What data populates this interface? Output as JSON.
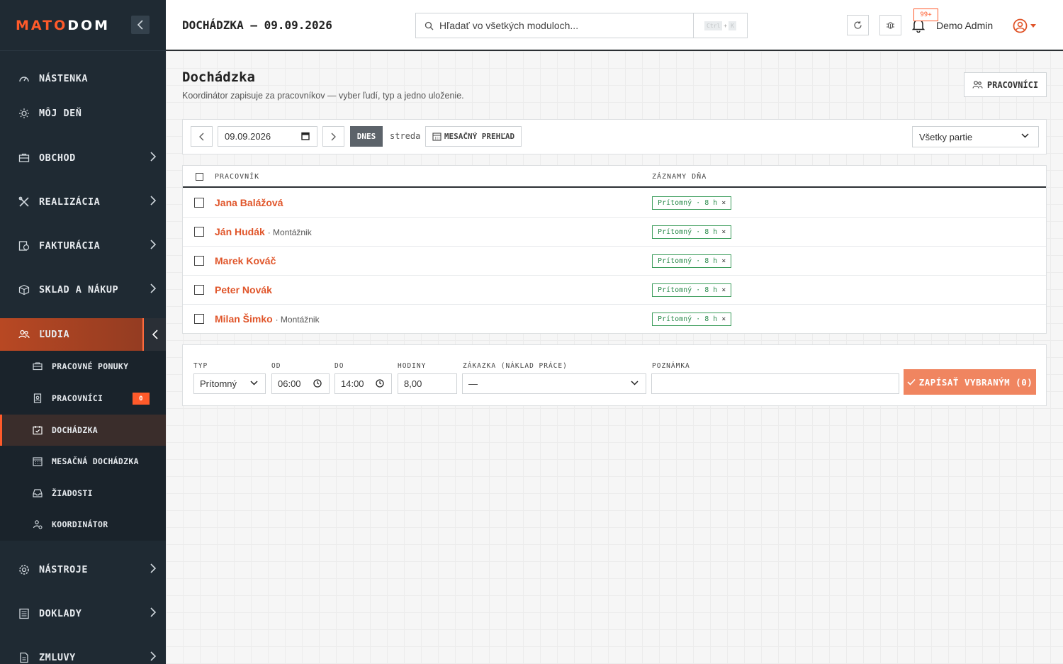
{
  "brand": {
    "logo_part1": "MATO",
    "logo_part2": "DOM"
  },
  "sidebar": {
    "items": [
      {
        "label": "NÁSTENKA",
        "icon": "gauge-icon"
      },
      {
        "label": "MÔJ DEŇ",
        "icon": "sun-icon"
      },
      {
        "label": "OBCHOD",
        "icon": "briefcase-icon"
      },
      {
        "label": "REALIZÁCIA",
        "icon": "tools-icon"
      },
      {
        "label": "FAKTURÁCIA",
        "icon": "invoice-icon"
      },
      {
        "label": "SKLAD A NÁKUP",
        "icon": "box-icon"
      },
      {
        "label": "ĽUDIA",
        "icon": "people-icon"
      },
      {
        "label": "NÁSTROJE",
        "icon": "gear-icon"
      },
      {
        "label": "DOKLADY",
        "icon": "list-icon"
      },
      {
        "label": "ZMLUVY",
        "icon": "document-icon"
      }
    ],
    "sub_items": [
      {
        "label": "PRACOVNÉ PONUKY",
        "icon": "briefcase-icon"
      },
      {
        "label": "PRACOVNÍCI",
        "icon": "badge-icon",
        "badge": "0"
      },
      {
        "label": "DOCHÁDZKA",
        "icon": "calendar-check-icon"
      },
      {
        "label": "MESAČNÁ DOCHÁDZKA",
        "icon": "calendar-grid-icon"
      },
      {
        "label": "ŽIADOSTI",
        "icon": "inbox-icon"
      },
      {
        "label": "KOORDINÁTOR",
        "icon": "coordinator-icon"
      }
    ]
  },
  "topbar": {
    "title": "DOCHÁDZKA — 09.09.2026",
    "search_placeholder": "Hľadať vo všetkých moduloch...",
    "kbd_ctrl": "Ctrl",
    "kbd_plus": "+",
    "kbd_key": "K",
    "notifications_badge": "99+",
    "user_name": "Demo Admin"
  },
  "page": {
    "title": "Dochádzka",
    "subtitle": "Koordinátor zapisuje za pracovníkov — vyber ľudí, typ a jedno uloženie.",
    "workers_button": "PRACOVNÍCI"
  },
  "toolbar": {
    "date_value": "09.09.2026",
    "today_label": "DNES",
    "weekday": "streda",
    "monthly_label": "MESAČNÝ PREHĽAD",
    "party_select": "Všetky partie"
  },
  "table": {
    "col_worker": "PRACOVNÍK",
    "col_records": "ZÁZNAMY DŇA",
    "rows": [
      {
        "name": "Jana Balážová",
        "role": "",
        "chip": "Prítomný · 8 h"
      },
      {
        "name": "Ján Hudák",
        "role": "· Montážnik",
        "chip": "Prítomný · 8 h"
      },
      {
        "name": "Marek Kováč",
        "role": "",
        "chip": "Prítomný · 8 h"
      },
      {
        "name": "Peter Novák",
        "role": "",
        "chip": "Prítomný · 8 h"
      },
      {
        "name": "Milan Šimko",
        "role": "· Montážnik",
        "chip": "Prítomný · 8 h"
      }
    ],
    "chip_close": "×"
  },
  "form": {
    "type_label": "TYP",
    "type_value": "Prítomný",
    "from_label": "OD",
    "from_value": "06:00",
    "to_label": "DO",
    "to_value": "14:00",
    "hours_label": "HODINY",
    "hours_value": "8,00",
    "order_label": "ZÁKAZKA (NÁKLAD PRÁCE)",
    "order_value": "—",
    "note_label": "POZNÁMKA",
    "note_value": "",
    "submit_label": "ZAPÍSAŤ VYBRANÝM (0)"
  },
  "colors": {
    "accent": "#ff5a2a",
    "sidebar_bg": "#1f2a33",
    "present_green": "#2f8d4f"
  }
}
